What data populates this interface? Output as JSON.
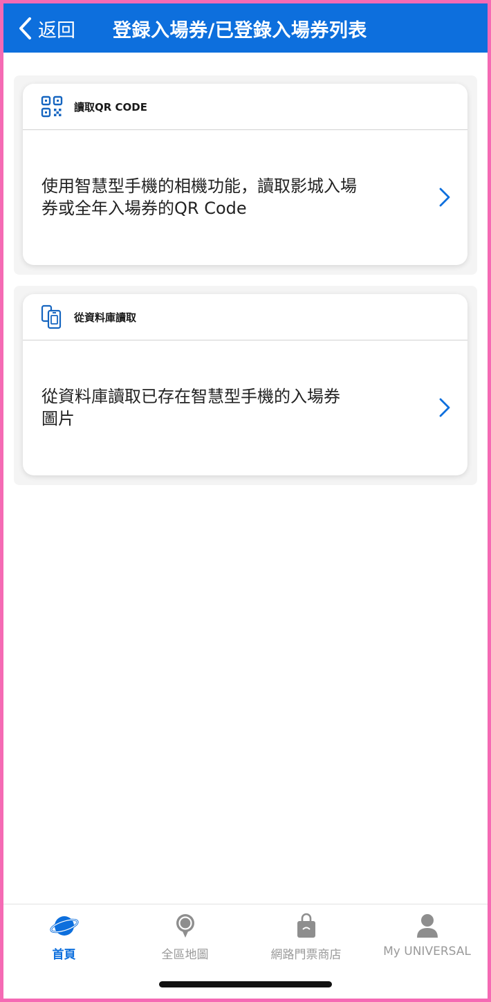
{
  "colors": {
    "primary": "#0d6fdd",
    "frame": "#f56ab4",
    "inactive": "#9a9a9a"
  },
  "header": {
    "back_label": "返回",
    "title": "登録入場券/已登錄入場券列表",
    "back_icon": "chevron-left-icon"
  },
  "cards": [
    {
      "icon": "qr-code-icon",
      "heading": "讀取QR CODE",
      "text_line1": "使用智慧型手機的相機功能，讀取影城入場",
      "text_line2": "券或全年入場券的QR Code",
      "chevron_icon": "chevron-right-icon"
    },
    {
      "icon": "phone-library-icon",
      "heading": "從資料庫讀取",
      "text_line1": "從資料庫讀取已存在智慧型手機的入場券",
      "text_line2": "圖片",
      "chevron_icon": "chevron-right-icon"
    }
  ],
  "tabbar": {
    "active": 0,
    "items": [
      {
        "label": "首頁",
        "icon": "globe-icon"
      },
      {
        "label": "全區地圖",
        "icon": "map-pin-icon"
      },
      {
        "label": "網路門票商店",
        "icon": "shopping-bag-icon"
      },
      {
        "label": "My UNIVERSAL",
        "icon": "user-icon"
      }
    ]
  }
}
